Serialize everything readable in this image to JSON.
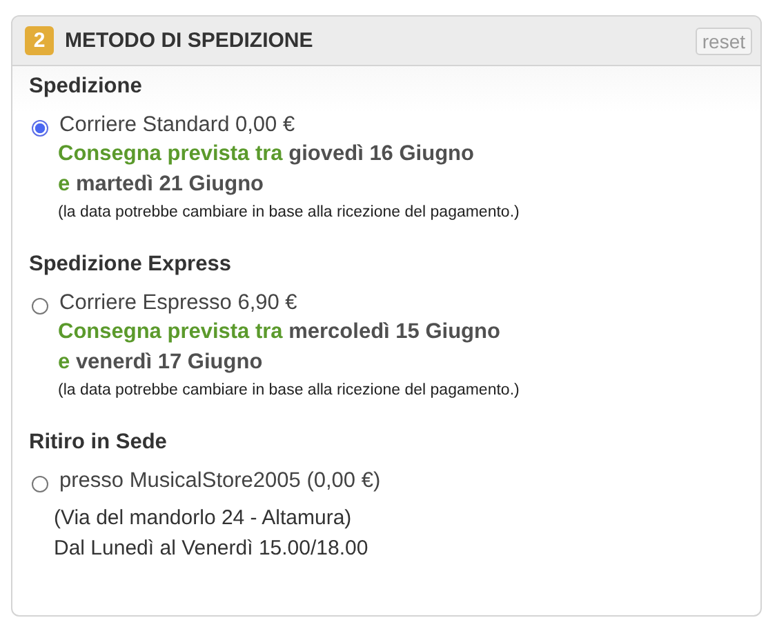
{
  "panel": {
    "step": "2",
    "title": "METODO DI SPEDIZIONE",
    "reset_label": "reset"
  },
  "groups": [
    {
      "heading": "Spedizione",
      "options": [
        {
          "kind": "delivery",
          "label": "Corriere Standard 0,00 €",
          "selected": true,
          "lead": "Consegna prevista tra",
          "date_from": "giovedì 16 Giugno",
          "joiner": "e",
          "date_to": "martedì 21 Giugno",
          "note": "(la data potrebbe cambiare in base alla ricezione del pagamento.)"
        }
      ]
    },
    {
      "heading": "Spedizione Express",
      "options": [
        {
          "kind": "delivery",
          "label": "Corriere Espresso 6,90 €",
          "selected": false,
          "lead": "Consegna prevista tra",
          "date_from": "mercoledì 15 Giugno",
          "joiner": "e",
          "date_to": "venerdì 17 Giugno",
          "note": "(la data potrebbe cambiare in base alla ricezione del pagamento.)"
        }
      ]
    },
    {
      "heading": "Ritiro in Sede",
      "options": [
        {
          "kind": "pickup",
          "label": "presso MusicalStore2005 (0,00 €)",
          "selected": false,
          "address": "(Via del mandorlo 24 - Altamura)",
          "hours": "Dal Lunedì al Venerdì 15.00/18.00"
        }
      ]
    }
  ]
}
